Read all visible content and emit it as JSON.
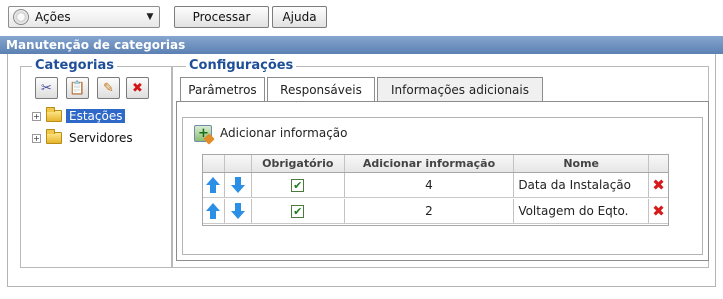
{
  "toolbar": {
    "actions_label": "Ações",
    "process_label": "Processar",
    "help_label": "Ajuda"
  },
  "header": {
    "title": "Manutenção de categorias"
  },
  "categories": {
    "legend": "Categorias",
    "icons": [
      "cut-icon",
      "paste-icon",
      "edit-icon",
      "delete-icon"
    ],
    "tree": [
      {
        "label": "Estações",
        "selected": true
      },
      {
        "label": "Servidores",
        "selected": false
      }
    ]
  },
  "config": {
    "legend": "Configurações",
    "tabs": [
      {
        "label": "Parâmetros",
        "active": false
      },
      {
        "label": "Responsáveis",
        "active": false
      },
      {
        "label": "Informações adicionais",
        "active": true
      }
    ],
    "add_info_label": "Adicionar informação",
    "grid": {
      "columns": [
        "",
        "",
        "Obrigatório",
        "Adicionar informação",
        "Nome",
        ""
      ],
      "rows": [
        {
          "required": true,
          "add_info": "4",
          "name": "Data da Instalação"
        },
        {
          "required": true,
          "add_info": "2",
          "name": "Voltagem do Eqto."
        }
      ]
    }
  },
  "colors": {
    "header_bar": "#5b80b2",
    "legend": "#1f4f97",
    "selected": "#2f69c8",
    "delete": "#d61b1b",
    "arrow": "#2b8fe5"
  }
}
